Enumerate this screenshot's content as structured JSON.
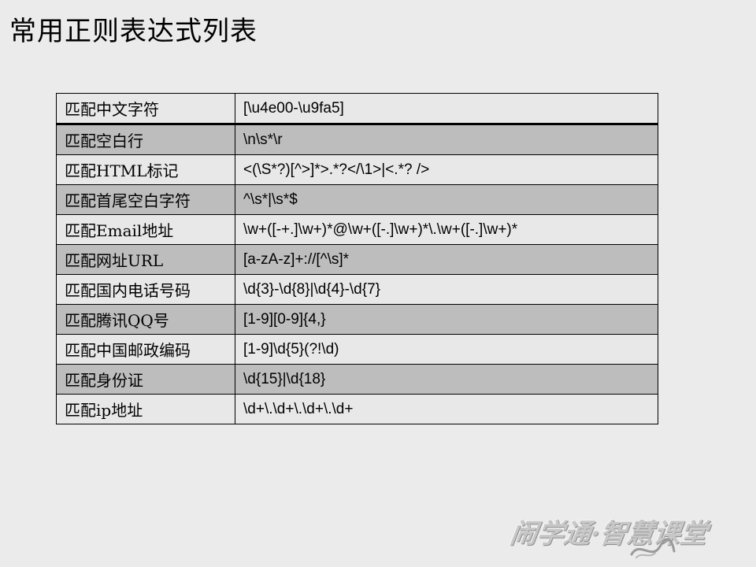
{
  "slide": {
    "title": "常用正则表达式列表"
  },
  "table": {
    "rows": [
      {
        "name": "匹配中文字符",
        "pattern": "[\\u4e00-\\u9fa5]"
      },
      {
        "name": "匹配空白行",
        "pattern": "\\n\\s*\\r"
      },
      {
        "name": "匹配HTML标记",
        "pattern": "<(\\S*?)[^>]*>.*?</\\1>|<.*? />"
      },
      {
        "name": "匹配首尾空白字符",
        "pattern": "^\\s*|\\s*$"
      },
      {
        "name": "匹配Email地址",
        "pattern": "\\w+([-+.]\\w+)*@\\w+([-.]\\w+)*\\.\\w+([-.]\\w+)*"
      },
      {
        "name": "匹配网址URL",
        "pattern": "[a-zA-z]+://[^\\s]*"
      },
      {
        "name": "匹配国内电话号码",
        "pattern": "\\d{3}-\\d{8}|\\d{4}-\\d{7}"
      },
      {
        "name": "匹配腾讯QQ号",
        "pattern": "[1-9][0-9]{4,}"
      },
      {
        "name": "匹配中国邮政编码",
        "pattern": "[1-9]\\d{5}(?!\\d)"
      },
      {
        "name": "匹配身份证",
        "pattern": "\\d{15}|\\d{18}"
      },
      {
        "name": "匹配ip地址",
        "pattern": "\\d+\\.\\d+\\.\\d+\\.\\d+"
      }
    ]
  },
  "watermark": {
    "text": "闹学通·智慧课堂"
  }
}
